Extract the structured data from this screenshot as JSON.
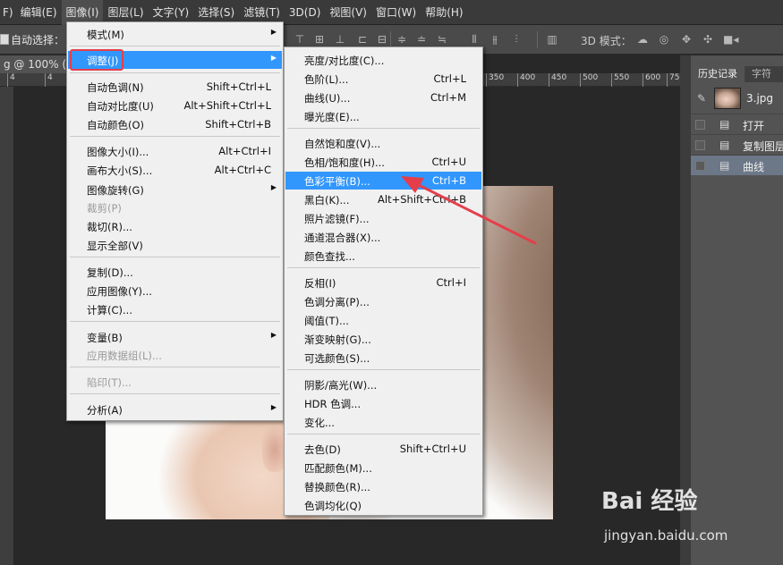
{
  "menubar": {
    "items": [
      "F)",
      "编辑(E)",
      "图像(I)",
      "图层(L)",
      "文字(Y)",
      "选择(S)",
      "滤镜(T)",
      "3D(D)",
      "视图(V)",
      "窗口(W)",
      "帮助(H)"
    ]
  },
  "options_bar": {
    "auto_select_label": "自动选择：",
    "mode_3d_label": "3D 模式："
  },
  "document": {
    "tab_title": "g @ 100% (背"
  },
  "ruler": {
    "ticks": [
      "4",
      "4",
      "350",
      "400",
      "450",
      "500",
      "550",
      "600",
      "650",
      "700",
      "750"
    ]
  },
  "panel": {
    "tabs": [
      "历史记录",
      "字符"
    ],
    "snapshot_name": "3.jpg",
    "history": [
      "打开",
      "复制图层",
      "曲线"
    ]
  },
  "image_menu": {
    "items": [
      {
        "label": "模式(M)",
        "shortcut": "",
        "submenu": true
      },
      {
        "label": "调整(J)",
        "shortcut": "",
        "submenu": true,
        "highlighted": true
      },
      {
        "label": "自动色调(N)",
        "shortcut": "Shift+Ctrl+L"
      },
      {
        "label": "自动对比度(U)",
        "shortcut": "Alt+Shift+Ctrl+L"
      },
      {
        "label": "自动颜色(O)",
        "shortcut": "Shift+Ctrl+B"
      },
      {
        "label": "图像大小(I)...",
        "shortcut": "Alt+Ctrl+I"
      },
      {
        "label": "画布大小(S)...",
        "shortcut": "Alt+Ctrl+C"
      },
      {
        "label": "图像旋转(G)",
        "shortcut": "",
        "submenu": true
      },
      {
        "label": "裁剪(P)",
        "shortcut": "",
        "disabled": true
      },
      {
        "label": "裁切(R)...",
        "shortcut": ""
      },
      {
        "label": "显示全部(V)",
        "shortcut": ""
      },
      {
        "label": "复制(D)...",
        "shortcut": ""
      },
      {
        "label": "应用图像(Y)...",
        "shortcut": ""
      },
      {
        "label": "计算(C)...",
        "shortcut": ""
      },
      {
        "label": "变量(B)",
        "shortcut": "",
        "submenu": true
      },
      {
        "label": "应用数据组(L)...",
        "shortcut": "",
        "disabled": true
      },
      {
        "label": "陷印(T)...",
        "shortcut": "",
        "disabled": true
      },
      {
        "label": "分析(A)",
        "shortcut": "",
        "submenu": true
      }
    ]
  },
  "adjust_menu": {
    "items": [
      {
        "label": "亮度/对比度(C)...",
        "shortcut": ""
      },
      {
        "label": "色阶(L)...",
        "shortcut": "Ctrl+L"
      },
      {
        "label": "曲线(U)...",
        "shortcut": "Ctrl+M"
      },
      {
        "label": "曝光度(E)...",
        "shortcut": ""
      },
      {
        "label": "自然饱和度(V)...",
        "shortcut": ""
      },
      {
        "label": "色相/饱和度(H)...",
        "shortcut": "Ctrl+U"
      },
      {
        "label": "色彩平衡(B)...",
        "shortcut": "Ctrl+B",
        "highlighted": true
      },
      {
        "label": "黑白(K)...",
        "shortcut": "Alt+Shift+Ctrl+B"
      },
      {
        "label": "照片滤镜(F)...",
        "shortcut": ""
      },
      {
        "label": "通道混合器(X)...",
        "shortcut": ""
      },
      {
        "label": "颜色查找...",
        "shortcut": ""
      },
      {
        "label": "反相(I)",
        "shortcut": "Ctrl+I"
      },
      {
        "label": "色调分离(P)...",
        "shortcut": ""
      },
      {
        "label": "阈值(T)...",
        "shortcut": ""
      },
      {
        "label": "渐变映射(G)...",
        "shortcut": ""
      },
      {
        "label": "可选颜色(S)...",
        "shortcut": ""
      },
      {
        "label": "阴影/高光(W)...",
        "shortcut": ""
      },
      {
        "label": "HDR 色调...",
        "shortcut": ""
      },
      {
        "label": "变化...",
        "shortcut": ""
      },
      {
        "label": "去色(D)",
        "shortcut": "Shift+Ctrl+U"
      },
      {
        "label": "匹配颜色(M)...",
        "shortcut": ""
      },
      {
        "label": "替换颜色(R)...",
        "shortcut": ""
      },
      {
        "label": "色调均化(Q)",
        "shortcut": ""
      }
    ]
  },
  "watermark": {
    "brand": "Bai 经验",
    "url": "jingyan.baidu.com"
  },
  "colors": {
    "highlight": "#3297fd",
    "annotation_red": "#e53e4a",
    "menu_bg": "#f0f0f0"
  }
}
